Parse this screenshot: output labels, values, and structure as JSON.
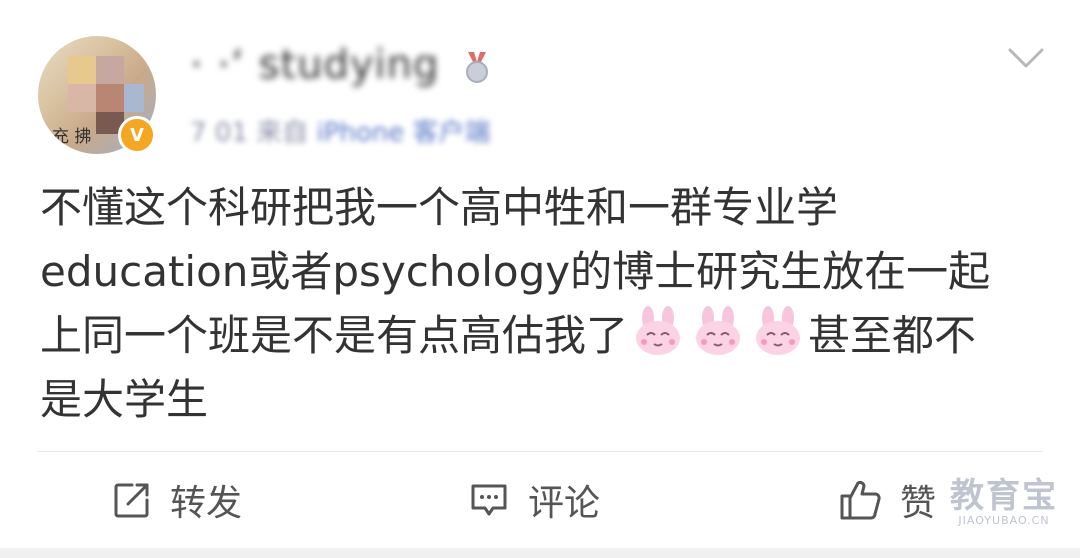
{
  "post": {
    "author": {
      "name": "· ·‘ studying",
      "avatar_text": "充 拂",
      "verified_mark": "V"
    },
    "meta": {
      "time": "7 01",
      "location": "来自",
      "source": "iPhone 客户端"
    },
    "content": {
      "line1": "不懂这个科研把我一个高中牲和一群专业学",
      "line2": "education或者psychology的博士研究生放在一起",
      "line3_a": "上同一个班是不是有点高估我了",
      "line3_b": "甚至都不",
      "line4": "是大学生"
    },
    "actions": {
      "repost_label": "转发",
      "comment_label": "评论",
      "like_label": "赞"
    }
  },
  "watermark": {
    "main": "教育宝",
    "sub": "JIAOYUBAO.CN"
  },
  "colors": {
    "text": "#333333",
    "meta": "#8a8ea8",
    "verified": "#f5a623",
    "emoji_pink": "#f7b8d3"
  }
}
